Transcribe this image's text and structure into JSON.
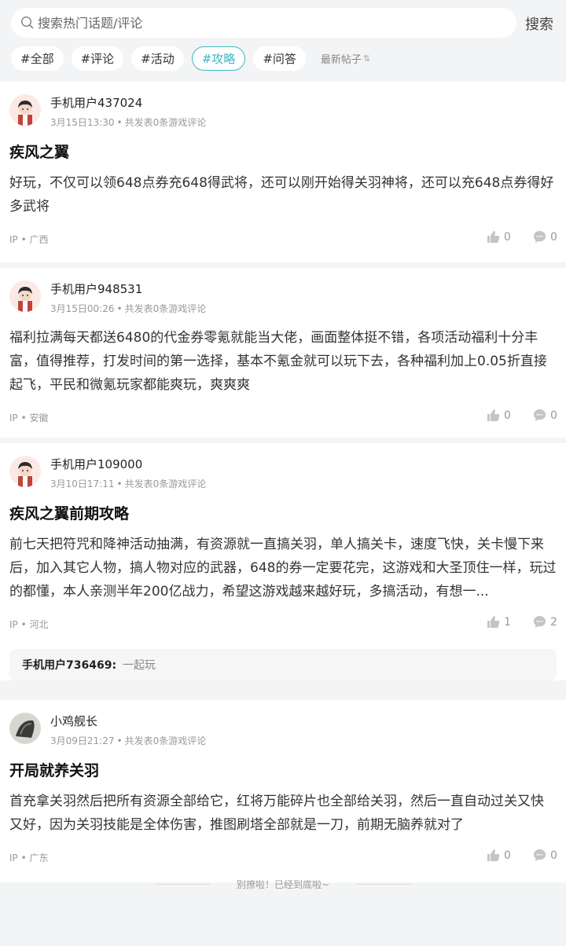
{
  "search": {
    "placeholder": "搜索热门话题/评论",
    "button": "搜索"
  },
  "tabs": [
    {
      "label": "#全部",
      "active": false
    },
    {
      "label": "#评论",
      "active": false
    },
    {
      "label": "#活动",
      "active": false
    },
    {
      "label": "#攻略",
      "active": true
    },
    {
      "label": "#问答",
      "active": false
    }
  ],
  "sort": {
    "label": "最新帖子",
    "icon": "sort-arrows-icon"
  },
  "accent_color": "#3fb6c1",
  "posts": [
    {
      "user": "手机用户437024",
      "time": "3月15日13:30",
      "stat_text": "共发表0条游戏评论",
      "title": "疾风之翼",
      "content": "好玩，不仅可以领648点券充648得武将，还可以刚开始得关羽神将，还可以充648点券得好多武将",
      "ip": "IP • 广西",
      "likes": "0",
      "comments": "0"
    },
    {
      "user": "手机用户948531",
      "time": "3月15日00:26",
      "stat_text": "共发表0条游戏评论",
      "title": "",
      "content": "福利拉满每天都送6480的代金券零氪就能当大佬，画面整体挺不错，各项活动福利十分丰富，值得推荐，打发时间的第一选择，基本不氪金就可以玩下去，各种福利加上0.05折直接起飞，平民和微氪玩家都能爽玩，爽爽爽",
      "ip": "IP • 安徽",
      "likes": "0",
      "comments": "0"
    },
    {
      "user": "手机用户109000",
      "time": "3月10日17:11",
      "stat_text": "共发表0条游戏评论",
      "title": "疾风之翼前期攻略",
      "content": "前七天把符咒和降神活动抽满，有资源就一直搞关羽，单人搞关卡，速度飞快，关卡慢下来后，加入其它人物，搞人物对应的武器，648的券一定要花完，这游戏和大圣顶住一样，玩过的都懂，本人亲测半年200亿战力，希望这游戏越来越好玩，多搞活动，有想一...",
      "ip": "IP • 河北",
      "likes": "1",
      "comments": "2",
      "reply": {
        "user": "手机用户736469:",
        "text": "一起玩"
      }
    },
    {
      "user": "小鸡舰长",
      "time": "3月09日21:27",
      "stat_text": "共发表0条游戏评论",
      "title": "开局就养关羽",
      "content": "首充拿关羽然后把所有资源全部给它，红将万能碎片也全部给关羽，然后一直自动过关又快又好，因为关羽技能是全体伤害，推图刷塔全部就是一刀，前期无脑养就对了",
      "ip": "IP • 广东",
      "likes": "0",
      "comments": "0"
    }
  ],
  "end_text": "别撩啦！已经到底啦~"
}
